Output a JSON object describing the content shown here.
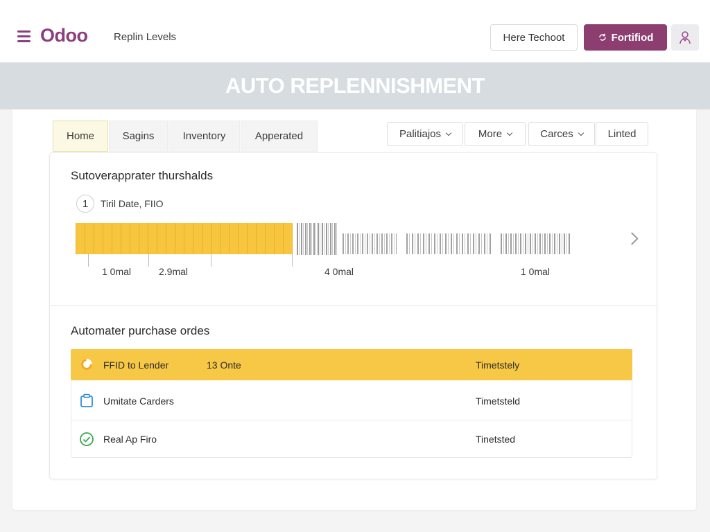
{
  "app": {
    "logo": "Odoo",
    "breadcrumb": "Replin Levels",
    "secondary_button": "Here Techoot",
    "primary_button": "Fortifiod",
    "primary_icon": "refresh-icon",
    "user_icon": "user-icon"
  },
  "banner": {
    "title": "AUTO REPLENNISHMENT"
  },
  "tabs": [
    {
      "label": "Home",
      "active": true
    },
    {
      "label": "Sagins",
      "active": false
    },
    {
      "label": "Inventory",
      "active": false
    },
    {
      "label": "Apperated",
      "active": false
    }
  ],
  "filters": [
    {
      "label": "Palitiajos",
      "has_dropdown": true
    },
    {
      "label": "More",
      "has_dropdown": true
    },
    {
      "label": "Carces",
      "has_dropdown": true
    },
    {
      "label": "Linted",
      "has_dropdown": false
    }
  ],
  "thresholds": {
    "title": "Sutoverapprater thurshalds",
    "step_number": "1",
    "step_label": "Tiril Date, FIIO",
    "axis_labels": [
      "1 0mal",
      "2.9mal",
      "4 0mal",
      "1 0mal"
    ]
  },
  "orders": {
    "title": "Automater purchase ordes",
    "rows": [
      {
        "name": "FFID to Lender",
        "qty": "13 Onte",
        "status": "Timetstely",
        "icon": "spinner-icon",
        "highlighted": true
      },
      {
        "name": "Umitate Carders",
        "qty": "",
        "status": "Timetsteld",
        "icon": "clipboard-icon",
        "highlighted": false
      },
      {
        "name": "Real Ap Firo",
        "qty": "",
        "status": "Tinetsted",
        "icon": "check-circle-icon",
        "highlighted": false
      }
    ]
  },
  "colors": {
    "brand": "#8b3e7f",
    "primary_button": "#8b3e6f",
    "banner": "#d6dcdf",
    "highlight": "#f7c845",
    "spinner": "#f4a820",
    "clipboard": "#2f8fd8",
    "check": "#38a84a"
  }
}
